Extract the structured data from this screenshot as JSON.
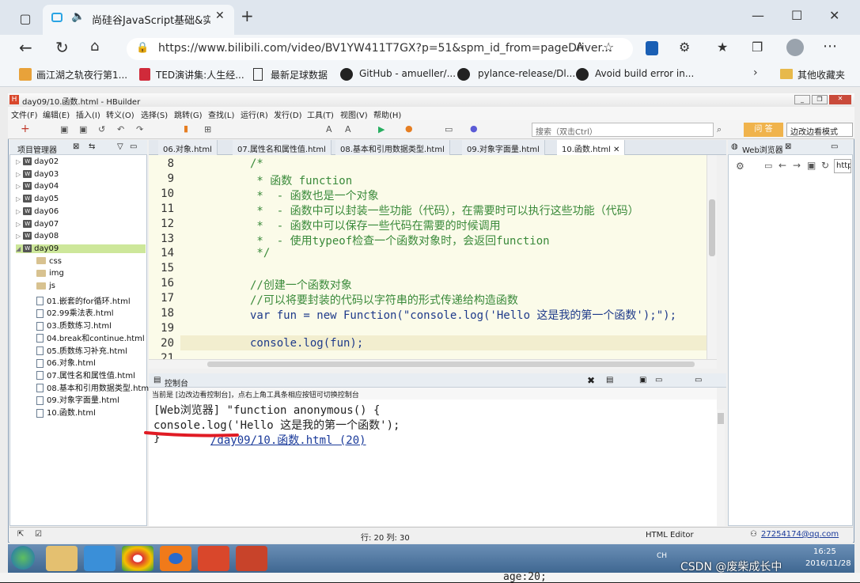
{
  "browser": {
    "tab_title": "尚硅谷JavaScript基础&实战",
    "url": "https://www.bilibili.com/video/BV1YW411T7GX?p=51&spm_id_from=pageDriver...",
    "favorites": [
      "画江湖之轨夜行第1...",
      "TED演讲集:人生经...",
      "最新足球数据",
      "GitHub - amueller/...",
      "pylance-release/Dl...",
      "Avoid build error in..."
    ],
    "other_favorites": "其他收藏夹"
  },
  "ide": {
    "title": "day09/10.函数.html - HBuilder",
    "menu": [
      "文件(F)",
      "编辑(E)",
      "插入(I)",
      "转义(O)",
      "选择(S)",
      "跳转(G)",
      "查找(L)",
      "运行(R)",
      "发行(D)",
      "工具(T)",
      "视图(V)",
      "帮助(H)"
    ],
    "search_placeholder": "搜索（双击Ctrl）",
    "zh_button": "问 答",
    "mode": "边改边看模式",
    "project_panel_title": "项目管理器",
    "tree": {
      "days": [
        "day02",
        "day03",
        "day04",
        "day05",
        "day06",
        "day07",
        "day08",
        "day09"
      ],
      "folders": [
        "css",
        "img",
        "js"
      ],
      "files": [
        "01.嵌套的for循环.html",
        "02.99乘法表.html",
        "03.质数练习.html",
        "04.break和continue.html",
        "05.质数练习补充.html",
        "06.对象.html",
        "07.属性名和属性值.html",
        "08.基本和引用数据类型.html",
        "09.对象字面量.html",
        "10.函数.html"
      ]
    },
    "editor_tabs": [
      "06.对象.html",
      "07.属性名和属性值.html",
      "08.基本和引用数据类型.html",
      "09.对象字面量.html",
      "10.函数.html"
    ],
    "code_lines": [
      {
        "n": "8",
        "text": "/*"
      },
      {
        "n": "9",
        "text": " * 函数 function"
      },
      {
        "n": "10",
        "text": " *  - 函数也是一个对象"
      },
      {
        "n": "11",
        "text": " *  - 函数中可以封装一些功能（代码），在需要时可以执行这些功能（代码）"
      },
      {
        "n": "12",
        "text": " *  - 函数中可以保存一些代码在需要的时候调用"
      },
      {
        "n": "13",
        "text": " *  - 使用typeof检查一个函数对象时，会返回function"
      },
      {
        "n": "14",
        "text": " */"
      },
      {
        "n": "15",
        "text": ""
      },
      {
        "n": "16",
        "text": "//创建一个函数对象"
      },
      {
        "n": "17",
        "text": "//可以将要封装的代码以字符串的形式传递给构造函数"
      },
      {
        "n": "18",
        "text": "var fun = new Function(\"console.log('Hello 这是我的第一个函数');\");"
      },
      {
        "n": "19",
        "text": ""
      },
      {
        "n": "20",
        "text": "console.log(fun);"
      },
      {
        "n": "21",
        "text": ""
      }
    ],
    "console_title": "控制台",
    "console_info": "当前是 [边改边看控制台]，点右上角工具条相应按钮可切换控制台",
    "console_lines": [
      "[Web浏览器] \"function anonymous() {",
      "console.log('Hello 这是我的第一个函数');",
      "}"
    ],
    "console_link": "/day09/10.函数.html (20)",
    "web_panel_title": "Web浏览器",
    "web_url": "http",
    "status_position": "行: 20 列: 30",
    "status_editor": "HTML Editor",
    "status_user": "27254174@qq.com"
  },
  "taskbar": {
    "time": "16:25",
    "date": "2016/11/28",
    "lang": "CH"
  },
  "watermark": "CSDN @废柴成长中",
  "bottom_code": "age:20;"
}
